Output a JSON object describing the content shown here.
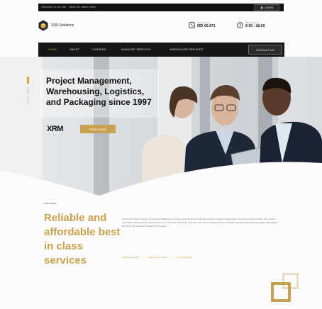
{
  "topbar": {
    "info_text": "Welcome to our site · follow the latest news",
    "button_label": "LOGIN"
  },
  "header": {
    "logo_text": "XRS Solutions",
    "contacts": [
      {
        "label": "Call us today",
        "value": "800-00-871"
      },
      {
        "label": "Working hours",
        "value": "9:00 - 18:00"
      }
    ]
  },
  "nav": {
    "items": [
      "HOME",
      "ABOUT",
      "CAREERS",
      "MANAGED SERVICES",
      "WAREHOUSE SERVICES"
    ],
    "cta_label": "CONTACT US"
  },
  "hero": {
    "title": "Project Management, Warehousing, Logistics, and Packaging since 1997",
    "partner_logo": "XRM",
    "button_label": "READ MORE",
    "slides_total": 3,
    "slide_active": 1
  },
  "intro": {
    "section_label": "OUR VISION",
    "tagline": "Reliable and affordable best in class services",
    "body": "Lorem ipsum dolor sit amet, consectetur adipiscing elit, sed do eiusmod tempor incididunt ut labore et dolore magna aliqua. Ut enim ad minim veniam, quis nostrud exercitation ullamco laboris nisi ut aliquip ex ea commodo consequat. Duis aute irure dolor in reprehenderit in voluptate velit esse cillum dolore eu fugiat nulla pariatur. Excepteur sint occaecat cupidatat non proident.",
    "links": [
      "Managed services",
      "Warehouse services",
      "Consultant Sage"
    ]
  },
  "colors": {
    "accent": "#caa24f",
    "dark": "#161616",
    "text": "#111111"
  },
  "icons": {
    "logo": "hexagon-logo-icon",
    "phone": "phone-icon",
    "clock": "clock-icon",
    "login": "user-icon"
  }
}
